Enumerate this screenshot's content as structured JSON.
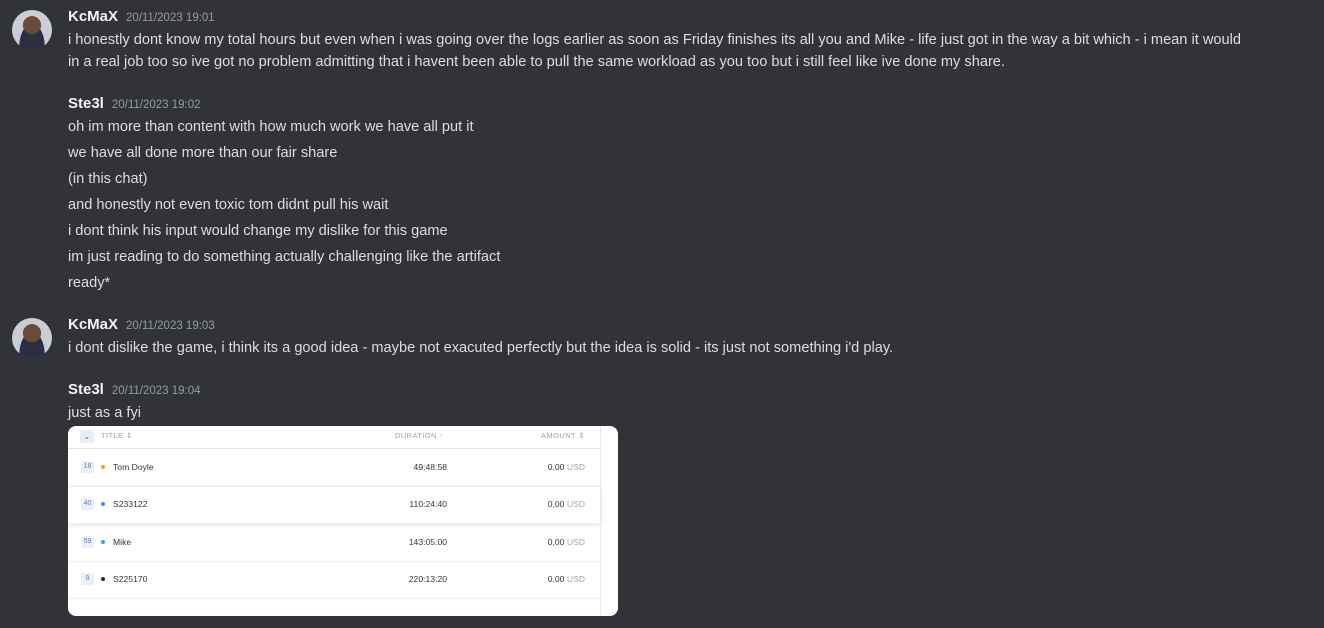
{
  "messages": [
    {
      "author": "KcMaX",
      "timestamp": "20/11/2023 19:01",
      "lines": [
        "i honestly dont know my total hours but even when i was going over the logs earlier as soon as Friday finishes its all you and Mike - life just got in the way a bit which - i mean it would",
        "in a real job too so ive got no problem admitting that i havent been able to pull the same workload as you too but i still feel like ive done my share."
      ]
    },
    {
      "author": "Ste3l",
      "timestamp": "20/11/2023 19:02",
      "lines": [
        "oh im more than content with how much work we have all put it",
        "we have all done more than our fair share",
        "(in this chat)",
        "and honestly not even toxic tom didnt pull his wait",
        "i dont think his input would change my dislike for this game",
        "im just reading to do something actually challenging like the artifact",
        "ready*"
      ]
    },
    {
      "author": "KcMaX",
      "timestamp": "20/11/2023 19:03",
      "lines": [
        "i dont dislike the game, i think its a good idea - maybe not exacuted perfectly but the idea is solid - its just not something i'd play."
      ]
    },
    {
      "author": "Ste3l",
      "timestamp": "20/11/2023 19:04",
      "lines": [
        "just as a fyi"
      ]
    }
  ],
  "attachment": {
    "headers": {
      "chevron": "⌄",
      "title": "TITLE ⇕",
      "duration": "DURATION ↑",
      "amount": "AMOUNT ⇕"
    },
    "rows": [
      {
        "num": "18",
        "dot_color": "#f2a516",
        "title": "Tom Doyle",
        "duration": "49:48:58",
        "amount": "0,00",
        "currency": "USD"
      },
      {
        "num": "40",
        "dot_color": "#2f8fe0",
        "title": "S233122",
        "duration": "110:24:40",
        "amount": "0,00",
        "currency": "USD"
      },
      {
        "num": "59",
        "dot_color": "#27a9e1",
        "title": "Mike",
        "duration": "143:05:00",
        "amount": "0,00",
        "currency": "USD"
      },
      {
        "num": "9",
        "dot_color": "#1f2a3a",
        "title": "S225170",
        "duration": "220:13:20",
        "amount": "0,00",
        "currency": "USD"
      }
    ]
  }
}
